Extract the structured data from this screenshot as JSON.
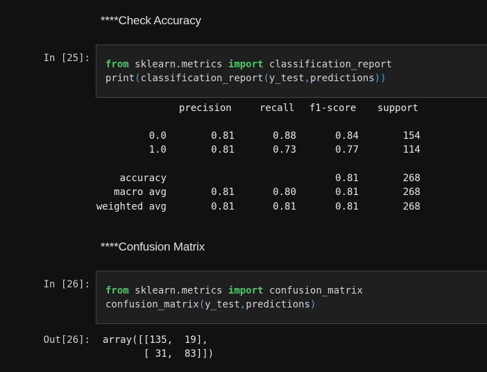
{
  "top_strip": "' ' ' ' ' ' ' ' ' ' ' ' ' ' ' ' ' ' ' ' ' ' ' ' ' ' ' ' ' ' ' ' ' '",
  "headings": {
    "check_accuracy": "****Check Accuracy",
    "confusion_matrix": "****Confusion Matrix"
  },
  "cell25": {
    "prompt": "In [25]:",
    "line1": {
      "kw_from": "from",
      "module": " sklearn.metrics ",
      "kw_import": "import",
      "name": " classification_report"
    },
    "line2": {
      "func": "print",
      "open": "(",
      "inner": "classification_report",
      "open2": "(",
      "args": "y_test",
      "comma": ",",
      "args2": "predictions",
      "close": "))"
    }
  },
  "report": {
    "headers": [
      "precision",
      "recall",
      "f1-score",
      "support"
    ],
    "rows": [
      {
        "label": "0.0",
        "precision": "0.81",
        "recall": "0.88",
        "f1": "0.84",
        "support": "154"
      },
      {
        "label": "1.0",
        "precision": "0.81",
        "recall": "0.73",
        "f1": "0.77",
        "support": "114"
      },
      {
        "label": "accuracy",
        "precision": "",
        "recall": "",
        "f1": "0.81",
        "support": "268"
      },
      {
        "label": "macro avg",
        "precision": "0.81",
        "recall": "0.80",
        "f1": "0.81",
        "support": "268"
      },
      {
        "label": "weighted avg",
        "precision": "0.81",
        "recall": "0.81",
        "f1": "0.81",
        "support": "268"
      }
    ]
  },
  "cell26": {
    "prompt": "In [26]:",
    "line1": {
      "kw_from": "from",
      "module": " sklearn.metrics ",
      "kw_import": "import",
      "name": " confusion_matrix"
    },
    "line2": {
      "func": "confusion_matrix",
      "open": "(",
      "args": "y_test",
      "comma": ",",
      "args2": "predictions",
      "close": ")"
    }
  },
  "out26": {
    "prompt": "Out[26]:",
    "line1": "array([[135,  19],",
    "line2": "       [ 31,  83]])"
  }
}
